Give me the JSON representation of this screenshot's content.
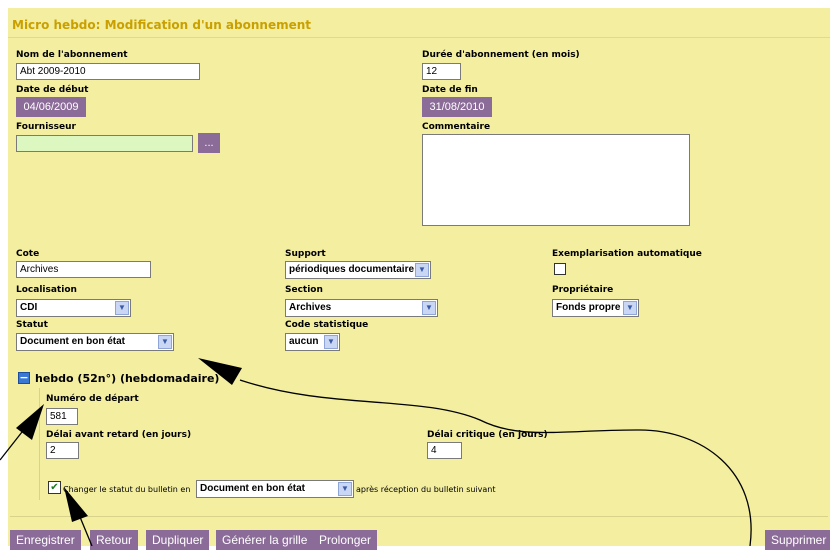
{
  "title": "Micro hebdo: Modification d'un abonnement",
  "fields": {
    "nom_label": "Nom de l'abonnement",
    "nom_value": "Abt 2009-2010",
    "duree_label": "Durée d'abonnement (en mois)",
    "duree_value": "12",
    "date_debut_label": "Date de début",
    "date_debut_value": "04/06/2009",
    "date_fin_label": "Date de fin",
    "date_fin_value": "31/08/2010",
    "fournisseur_label": "Fournisseur",
    "fournisseur_value": "",
    "fournisseur_btn": "...",
    "commentaire_label": "Commentaire",
    "commentaire_value": "",
    "cote_label": "Cote",
    "cote_value": "Archives",
    "support_label": "Support",
    "support_value": "périodiques documentaire",
    "exemplarisation_label": "Exemplarisation automatique",
    "localisation_label": "Localisation",
    "localisation_value": "CDI",
    "section_label": "Section",
    "section_value": "Archives",
    "proprietaire_label": "Propriétaire",
    "proprietaire_value": "Fonds propre",
    "statut_label": "Statut",
    "statut_value": "Document en bon état",
    "code_stat_label": "Code statistique",
    "code_stat_value": "aucun"
  },
  "periodicity": {
    "toggle_symbol": "−",
    "heading": "hebdo (52n°) (hebdomadaire)",
    "numero_label": "Numéro de départ",
    "numero_value": "581",
    "delai_retard_label": "Délai avant retard (en jours)",
    "delai_retard_value": "2",
    "delai_critique_label": "Délai critique (en jours)",
    "delai_critique_value": "4",
    "change_status_prefix": "Changer le statut du bulletin en",
    "change_status_value": "Document en bon état",
    "change_status_suffix": "après réception du bulletin suivant",
    "checkmark": "✔"
  },
  "buttons": {
    "enregistrer": "Enregistrer",
    "retour": "Retour",
    "dupliquer": "Dupliquer",
    "generer": "Générer la grille",
    "prolonger": "Prolonger",
    "supprimer": "Supprimer"
  },
  "icons": {
    "dropdown": "▼"
  },
  "colors": {
    "panel_bg": "#f3eea0",
    "title_color": "#c9a000",
    "button_bg": "#8b6b97",
    "fournisseur_bg": "#ddf7c0"
  }
}
